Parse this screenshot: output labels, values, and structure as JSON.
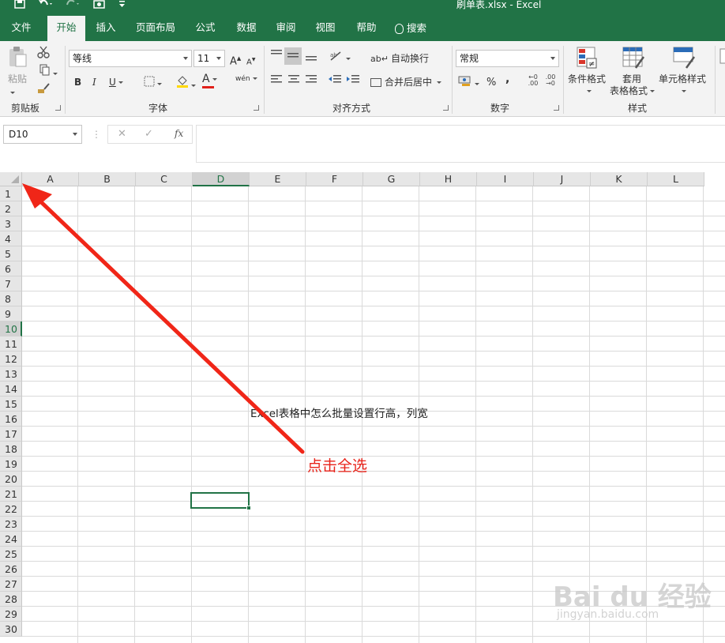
{
  "title_bar": {
    "document_title": "刷单表.xlsx  -  Excel",
    "quick_access": [
      "save-icon",
      "undo-icon",
      "redo-icon",
      "camera-icon",
      "customize-icon"
    ]
  },
  "tabs": [
    {
      "label": "文件"
    },
    {
      "label": "开始",
      "active": true
    },
    {
      "label": "插入"
    },
    {
      "label": "页面布局"
    },
    {
      "label": "公式"
    },
    {
      "label": "数据"
    },
    {
      "label": "审阅"
    },
    {
      "label": "视图"
    },
    {
      "label": "帮助"
    },
    {
      "label": "搜索"
    }
  ],
  "ribbon": {
    "clipboard": {
      "paste_label": "粘贴",
      "group_label": "剪贴板"
    },
    "font": {
      "font_name": "等线",
      "font_size": "11",
      "bold": "B",
      "italic": "I",
      "underline": "U",
      "grow": "A",
      "shrink": "A",
      "font_color": "A",
      "phonetic": "wén",
      "group_label": "字体"
    },
    "alignment": {
      "wrap_text": "自动换行",
      "merge_center": "合并后居中",
      "group_label": "对齐方式"
    },
    "number": {
      "format": "常规",
      "percent": "%",
      "comma": ",",
      "group_label": "数字"
    },
    "styles": {
      "conditional": "条件格式",
      "table_format_1": "套用",
      "table_format_2": "表格格式",
      "cell_styles": "单元格样式",
      "group_label": "样式"
    }
  },
  "formula_bar": {
    "name_box": "D10",
    "cancel": "✕",
    "enter": "✓",
    "fx": "fx",
    "content": ""
  },
  "sheet": {
    "columns": [
      "A",
      "B",
      "C",
      "D",
      "E",
      "F",
      "G",
      "H",
      "I",
      "J",
      "K",
      "L"
    ],
    "selected_column": "D",
    "rows": [
      "1",
      "2",
      "3",
      "4",
      "5",
      "6",
      "7",
      "8",
      "9",
      "10",
      "11",
      "12",
      "13",
      "14",
      "15",
      "16",
      "17",
      "18",
      "19",
      "20",
      "21",
      "22",
      "23",
      "24",
      "25",
      "26",
      "27",
      "28",
      "29",
      "30"
    ],
    "selected_row": "10",
    "cell_E4": "Excel表格中怎么批量设置行高，列宽"
  },
  "annotation": {
    "text": "点击全选",
    "color": "#e8231a"
  },
  "watermark": {
    "text": "Bai du 经验",
    "url": "jingyan.baidu.com"
  },
  "colors": {
    "excel_green": "#217346",
    "ribbon_bg": "#f3f3f3"
  }
}
